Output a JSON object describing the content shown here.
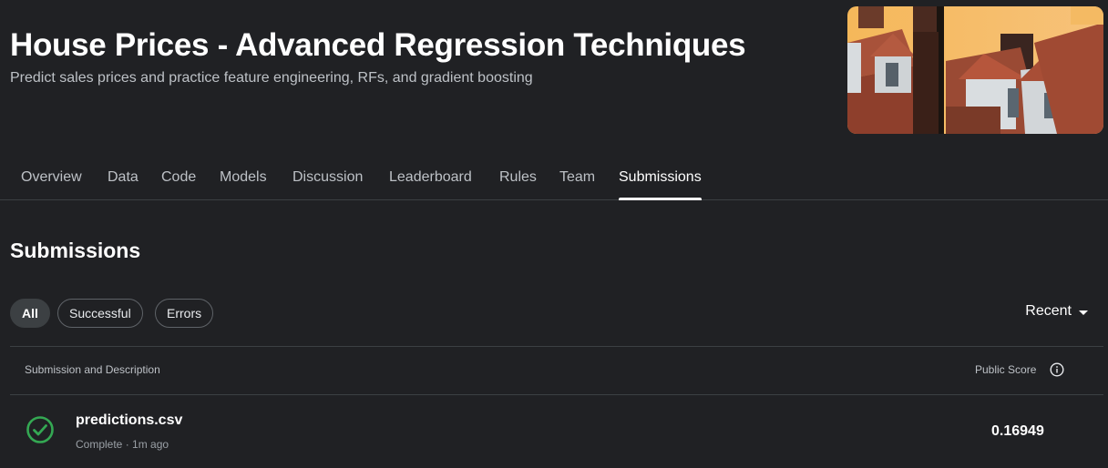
{
  "header": {
    "title": "House Prices - Advanced Regression Techniques",
    "subtitle": "Predict sales prices and practice feature engineering, RFs, and gradient boosting"
  },
  "tabs": [
    {
      "label": "Overview"
    },
    {
      "label": "Data"
    },
    {
      "label": "Code"
    },
    {
      "label": "Models"
    },
    {
      "label": "Discussion"
    },
    {
      "label": "Leaderboard"
    },
    {
      "label": "Rules"
    },
    {
      "label": "Team"
    },
    {
      "label": "Submissions",
      "active": true
    }
  ],
  "submissions": {
    "title": "Submissions",
    "filters": [
      {
        "label": "All",
        "selected": true
      },
      {
        "label": "Successful"
      },
      {
        "label": "Errors"
      }
    ],
    "sort_label": "Recent",
    "columns": {
      "description": "Submission and Description",
      "score": "Public Score"
    },
    "rows": [
      {
        "file": "predictions.csv",
        "status": "Complete · 1m ago",
        "score": "0.16949",
        "status_icon": "check-circle-icon"
      }
    ]
  },
  "colors": {
    "background": "#202124",
    "success": "#34a853",
    "text": "#ffffff"
  }
}
